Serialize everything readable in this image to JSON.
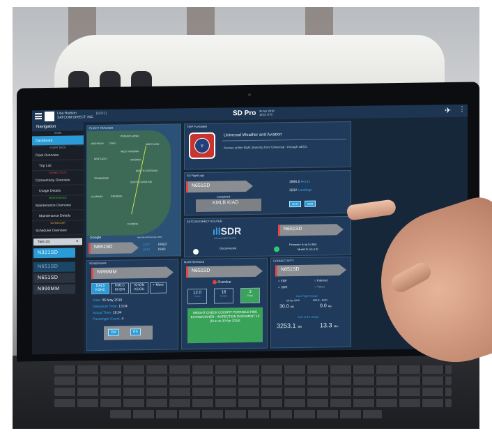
{
  "header": {
    "user_name": "Lisa Hudson",
    "company": "SATCOM DIRECT, INC",
    "tail": "[N321]",
    "brand": "SD Pro",
    "date": "25 Apr 2016",
    "time": "18:51 UTC"
  },
  "sidebar": {
    "title": "Navigation",
    "sections": {
      "home": "HOME",
      "flight_deck": "FLIGHT DECK",
      "connectivity": "CONNECTIVITY",
      "maintenance": "MAINTENANCE",
      "scheduler": "SCHEDULER"
    },
    "items": [
      "Dashboard",
      "Fleet Overview",
      "Trip List",
      "Connectivity Overview",
      "Usage Details",
      "Maintenance Overview",
      "Maintenance Details",
      "Scheduler Overview"
    ],
    "tail_select": "Tails (3)",
    "tails": [
      "N321SD",
      "N651SD",
      "N651SD",
      "N990MM"
    ]
  },
  "flight_tracker": {
    "title": "FLIGHT TRACKER",
    "labels": [
      "PENNSYLVANIA",
      "MICHIGAN",
      "OHIO",
      "MARYLAND",
      "WEST VIRGINIA",
      "KENTUCKY",
      "VIRGINIA",
      "NORTH CAROLINA",
      "TENNESSEE",
      "SOUTH CAROLINA",
      "GEORGIA",
      "ALABAMA",
      "FLORIDA"
    ],
    "google": "Google",
    "map_data": "Map data ©2016 Google, INEGI",
    "tail": "N651SD",
    "dep_time": "13:37",
    "arr_time": "16:13",
    "from": "KMLB",
    "to": "KIAD"
  },
  "trip_planner": {
    "title": "TRIP PLANNER",
    "name": "Universal Weather and Aviation",
    "description": "Access online flight planning from Universal - through sdGO."
  },
  "flight_logs": {
    "title": "SD FlightLogs",
    "tail": "N651SD",
    "hours": "3896.5",
    "hours_label": "Hours",
    "landings": "3232",
    "landings_label": "Landings",
    "status": "Completed",
    "route": "KMLB  KIAD",
    "route_sub": "25 Apr 2016 13:37 - 16:13",
    "btn_a": "Wi-Fi",
    "btn_b": "SDR"
  },
  "satcom": {
    "title": "SATCOM DIRECT ROUTER",
    "logo": "SDR",
    "logo_sub": "SATCOM DIRECT ROUTER",
    "tail": "N651SD",
    "status": "Disconnected",
    "firmware": "Firmware is up to date",
    "model": "Model D (v5.4.0)"
  },
  "scheduler": {
    "title": "SCHEDULER",
    "tail": "N990MM",
    "legs": [
      "DAL5 KSHC",
      "KMLC KHON",
      "KHON KCOU",
      "+ More"
    ],
    "date_label": "Date:",
    "date": "05 May 2016",
    "dep_label": "Departure Time:",
    "dep": "13:04",
    "arr_label": "Actual Time:",
    "arr": "16:04",
    "pax_label": "Passenger Count:",
    "pax": "4",
    "btn_dm": "DM",
    "btn_rs": "RS"
  },
  "maintenance": {
    "title": "MAINTENANCE",
    "tail": "N651SD",
    "status": "Overdue",
    "stats": [
      {
        "value": "12.0",
        "label": "Hours"
      },
      {
        "value": "16",
        "label": "Cycles"
      },
      {
        "value": "3",
        "label": "Days"
      }
    ],
    "task": "WEIGHT CHECK COCKPIT PORTABLE FIRE EXTINGUISHER - INSPECTION DOCUMENT 19",
    "due": "(Due on 30 Apr 2016)"
  },
  "connectivity": {
    "title": "CONNECTIVITY",
    "tail": "N651SD",
    "options": [
      "FDF",
      "Internet",
      "SDR",
      "Voice"
    ],
    "last_flight": "Last Flight Usage",
    "flight_date": "25 Apr 2016",
    "flight_route": "KMLB - KIAD",
    "usage1": "30.0",
    "unit1": "MB",
    "usage2": "0.0",
    "unit2": "Min",
    "month": "April 2016 Usage",
    "month_mb": "3253.1",
    "month_mb_unit": "MB",
    "month_min": "13.3",
    "month_min_unit": "Min"
  },
  "colors": {
    "accent": "#2a9bd6",
    "panel": "#1f3a5a",
    "overdue": "#e04040",
    "ok": "#2ecc71"
  }
}
